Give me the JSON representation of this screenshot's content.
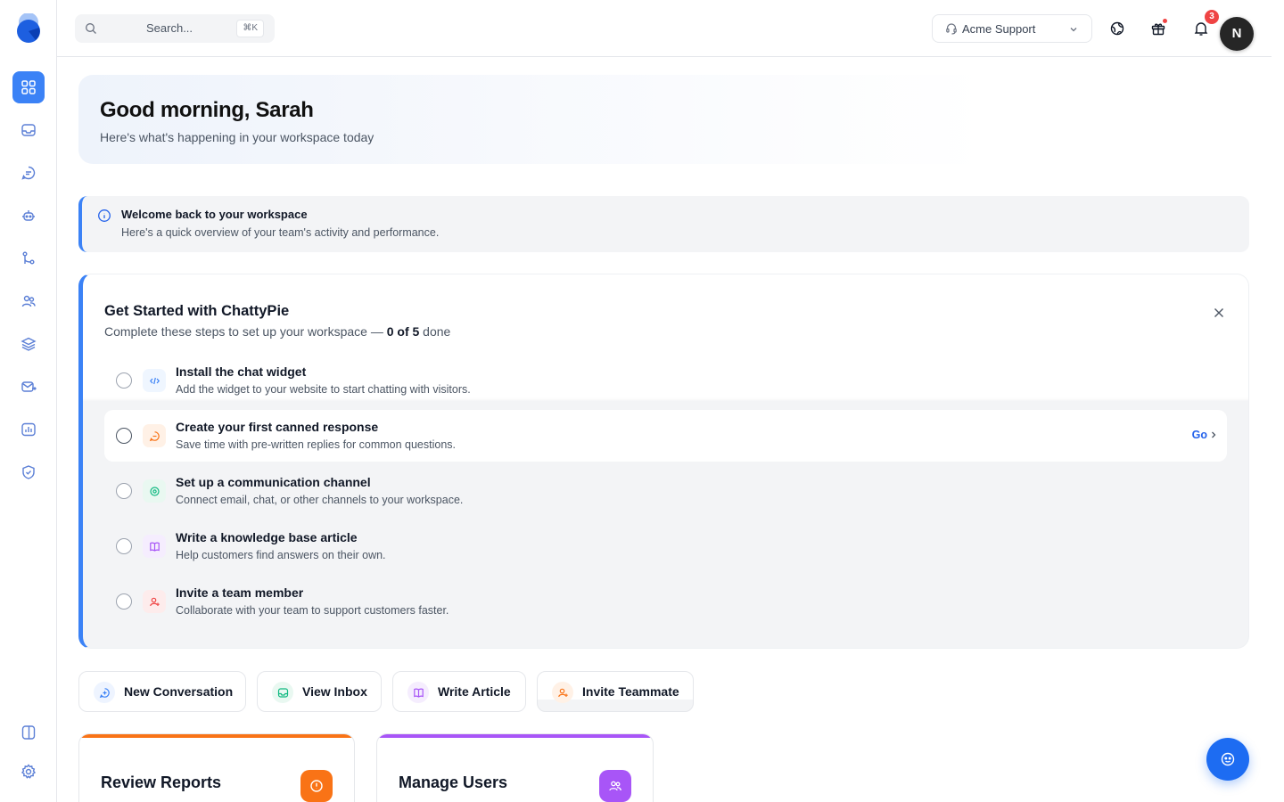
{
  "search": {
    "placeholder": "Search...",
    "shortcut": "⌘K"
  },
  "workspace": {
    "name": "Acme Support"
  },
  "notifications": {
    "count": "3"
  },
  "user": {
    "initial": "N"
  },
  "sidebar": {
    "items": [
      {
        "name": "dashboard",
        "icon": "grid-icon",
        "active": true
      },
      {
        "name": "inbox",
        "icon": "inbox-icon"
      },
      {
        "name": "conversations",
        "icon": "chat-bubble-icon"
      },
      {
        "name": "bots",
        "icon": "bot-icon"
      },
      {
        "name": "workflows",
        "icon": "git-branch-icon"
      },
      {
        "name": "contacts",
        "icon": "users-icon"
      },
      {
        "name": "knowledge-base",
        "icon": "layers-icon"
      },
      {
        "name": "campaigns",
        "icon": "mail-send-icon"
      },
      {
        "name": "reports",
        "icon": "bar-chart-icon"
      },
      {
        "name": "security",
        "icon": "shield-check-icon"
      }
    ],
    "bottom": [
      {
        "name": "toggle-panel",
        "icon": "sidebar-panel-icon"
      },
      {
        "name": "settings",
        "icon": "gear-icon"
      }
    ]
  },
  "hero": {
    "greeting": "Good morning, Sarah",
    "subtitle": "Here's what's happening in your workspace today"
  },
  "banner": {
    "title": "Welcome back to your workspace",
    "description": "Here's a quick overview of your team's activity and performance."
  },
  "get_started": {
    "title": "Get Started with ChattyPie",
    "subtitle_prefix": "Complete these steps to set up your workspace — ",
    "progress": "0 of 5",
    "subtitle_suffix": " done",
    "go_label": "Go",
    "steps": [
      {
        "title": "Install the chat widget",
        "description": "Add the widget to your website to start chatting with visitors.",
        "icon": "code-icon",
        "color": "#3b82f6"
      },
      {
        "title": "Create your first canned response",
        "description": "Save time with pre-written replies for common questions.",
        "icon": "message-icon",
        "color": "#f97316"
      },
      {
        "title": "Set up a communication channel",
        "description": "Connect email, chat, or other channels to your workspace.",
        "icon": "channel-icon",
        "color": "#10b981"
      },
      {
        "title": "Write a knowledge base article",
        "description": "Help customers find answers on their own.",
        "icon": "book-icon",
        "color": "#a855f7"
      },
      {
        "title": "Invite a team member",
        "description": "Collaborate with your team to support customers faster.",
        "icon": "user-plus-icon",
        "color": "#ef4444"
      }
    ]
  },
  "quick_actions": [
    {
      "label": "New Conversation",
      "icon": "chat-plus-icon",
      "color": "#3b82f6"
    },
    {
      "label": "View Inbox",
      "icon": "inbox-icon",
      "color": "#10b981"
    },
    {
      "label": "Write Article",
      "icon": "book-icon",
      "color": "#a855f7"
    },
    {
      "label": "Invite Teammate",
      "icon": "user-plus-icon",
      "color": "#f97316"
    }
  ],
  "cards": [
    {
      "title": "Review Reports",
      "icon": "alert-circle-icon",
      "color": "#f97316"
    },
    {
      "title": "Manage Users",
      "icon": "users-icon",
      "color": "#a855f7"
    }
  ],
  "colors": {
    "accent": "#3b82f6",
    "badge": "#ef4444",
    "fab": "#1d6cf2"
  }
}
